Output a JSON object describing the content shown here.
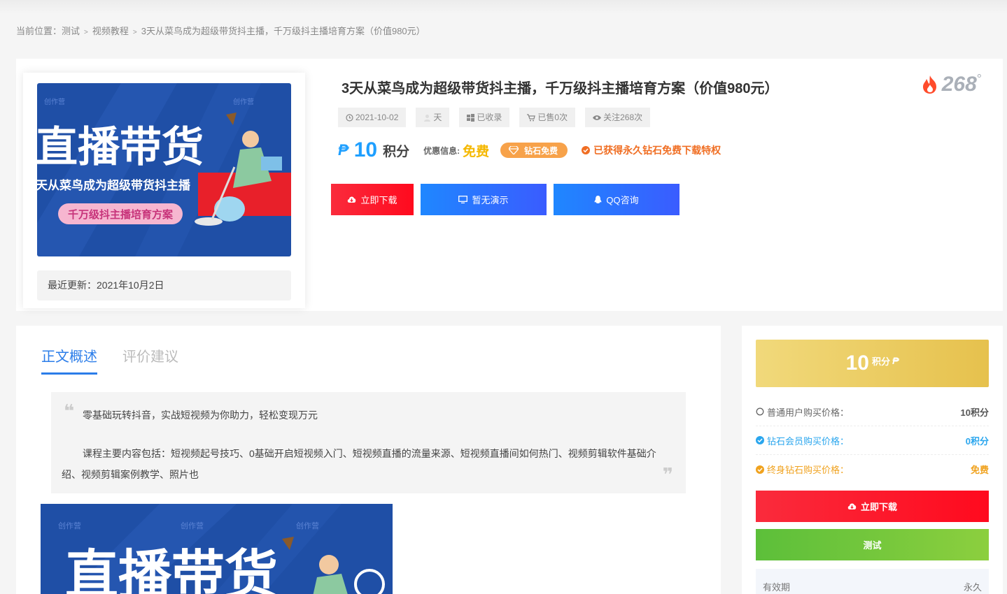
{
  "breadcrumb": {
    "prefix": "当前位置：",
    "items": [
      "测试",
      "视频教程",
      "3天从菜鸟成为超级带货抖主播，千万级抖主播培育方案（价值980元）"
    ],
    "separator": ">"
  },
  "product": {
    "title": "3天从菜鸟成为超级带货抖主播，千万级抖主播培育方案（价值980元）",
    "heat": "268",
    "heat_deg": "°",
    "update_text": "最近更新：2021年10月2日",
    "thumb": {
      "big_text": "直播带货",
      "sub_text": "天从菜鸟成为超级带货抖主播",
      "pill_text": "千万级抖主播培育方案",
      "watermark": "创作营"
    },
    "meta": [
      {
        "icon": "clock-icon",
        "label": "2021-10-02"
      },
      {
        "icon": "user-icon",
        "label": "天"
      },
      {
        "icon": "windows-icon",
        "label": "已收录"
      },
      {
        "icon": "cart-icon",
        "label": "已售0次"
      },
      {
        "icon": "eye-icon",
        "label": "关注268次"
      }
    ],
    "price": {
      "icon": "₱",
      "value": "10",
      "unit": "积分",
      "promo_label": "优惠信息:",
      "promo_value": "免费",
      "vip_badge": "钻石免费",
      "vip_note": "已获得永久钻石免费下载特权"
    },
    "actions": {
      "download": "立即下载",
      "demo": "暂无演示",
      "qq": "QQ咨询"
    }
  },
  "article": {
    "tabs": [
      {
        "label": "正文概述",
        "active": true
      },
      {
        "label": "评价建议",
        "active": false
      }
    ],
    "quote_open": "❝",
    "quote_close": "❞",
    "quote_p1": "零基础玩转抖音，实战短视频为你助力，轻松变现万元",
    "quote_p2": "课程主要内容包括：短视频起号技巧、0基础开启短视频入门、短视频直播的流量来源、短视频直播间如何热门、视频剪辑软件基础介绍、视频剪辑案例教学、照片也"
  },
  "sidebar": {
    "price_num": "10",
    "price_unit": "积分",
    "price_icon": "₱",
    "rows": [
      {
        "label": "普通用户购买价格：",
        "value": "10积分"
      },
      {
        "label": "钻石会员购买价格：",
        "value": "0积分"
      },
      {
        "label": "终身钻石购买价格：",
        "value": "免费"
      }
    ],
    "download": "立即下载",
    "test": "测试",
    "validity_label": "有效期",
    "validity_value": "永久"
  },
  "colors": {
    "accent_blue": "#1e9fff",
    "red": "#ff0a1e",
    "gold": "#e6c14d",
    "green": "#5cbf3a",
    "orange": "#f06e23"
  }
}
